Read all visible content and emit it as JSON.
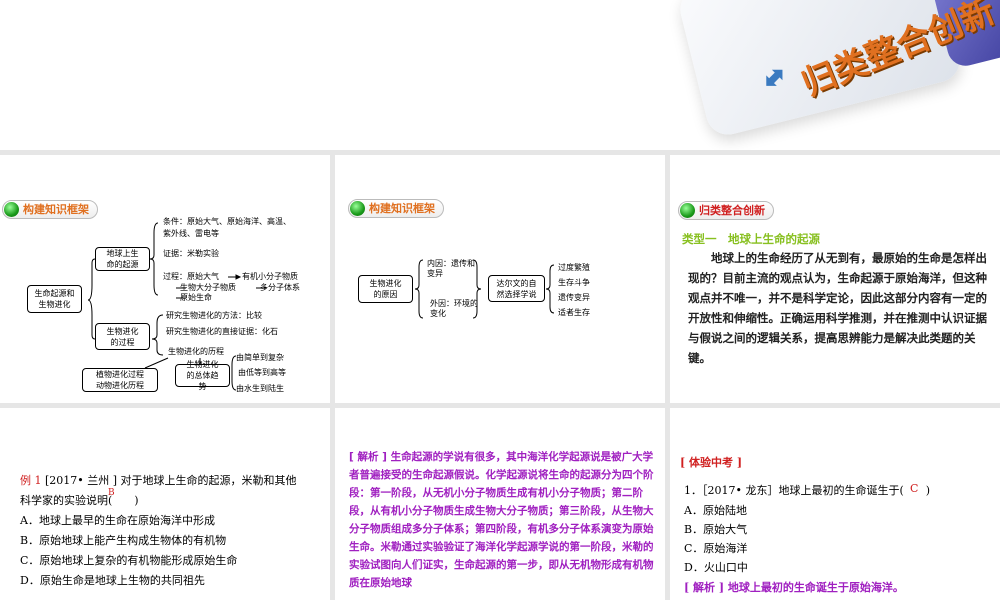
{
  "banner": {
    "title": "归类整合创新"
  },
  "panel1": {
    "badge": "构建知识框架",
    "root": "生命起源和生物进化",
    "origin": "地球上生命的起源",
    "conditions1": "条件：原始大气、原始海洋、高温、",
    "conditions2": "紫外线、雷电等",
    "evidence": "证据：米勒实验",
    "process1": "过程：原始大气",
    "process2": "有机小分子物质",
    "process3": "生物大分子物质",
    "process4": "多分子体系",
    "process5": "原始生命",
    "evolution": "生物进化的过程",
    "method": "研究生物进化的方法：比较",
    "direct": "研究生物进化的直接证据：化石",
    "history": "生物进化的历程",
    "plants": "植物进化过程动物进化历程",
    "trend": "生物进化的总体趋势",
    "trend1": "由简单到复杂",
    "trend2": "由低等到高等",
    "trend3": "由水生到陆生"
  },
  "panel2": {
    "badge": "构建知识框架",
    "cause": "生物进化的原因",
    "internal": "内因：遗传和变异",
    "external": "外因：环境的变化",
    "darwin": "达尔文的自然选择学说",
    "items": [
      "过度繁殖",
      "生存斗争",
      "遗传变异",
      "适者生存"
    ]
  },
  "panel3": {
    "badge": "归类整合创新",
    "heading": "类型一　地球上生命的起源",
    "body": "地球上的生命经历了从无到有，最原始的生命是怎样出现的？目前主流的观点认为，生命起源于原始海洋，但这种观点并不唯一，并不是科学定论，因此这部分内容有一定的开放性和伸缩性。正确运用科学推测，并在推测中认识证据与假说之间的逻辑关系，提高思辨能力是解决此类题的关键。"
  },
  "example": {
    "label": "例 1",
    "source": "[2017• 兰州 ] 对于地球上生命的起源，米勒和其他",
    "line2": "科学家的实验说明(　　)",
    "answer": "B",
    "options": [
      "A．地球上最早的生命在原始海洋中形成",
      "B．原始地球上能产生构成生物体的有机物",
      "C．原始地球上复杂的有机物能形成原始生命",
      "D．原始生命是地球上生物的共同祖先"
    ]
  },
  "analysis": {
    "text": "[ 解析 ] 生命起源的学说有很多，其中海洋化学起源说是被广大学者普遍接受的生命起源假说。化学起源说将生命的起源分为四个阶段：第一阶段，从无机小分子物质生成有机小分子物质；第二阶段，从有机小分子物质生成生物大分子物质；第三阶段，从生物大分子物质组成多分子体系；第四阶段，有机多分子体系演变为原始生命。米勒通过实验验证了海洋化学起源学说的第一阶段，米勒的实验试图向人们证实，生命起源的第一步，即从无机物形成有机物质在原始地球"
  },
  "exam": {
    "heading": "[ 体验中考 ]",
    "question": "1．［2017• 龙东］地球上最初的生命诞生于(　　)",
    "answer": "C",
    "options": [
      "A．原始陆地",
      "B．原始大气",
      "C．原始海洋",
      "D．火山口中"
    ],
    "analysis": "[ 解析 ] 地球上最初的生命诞生于原始海洋。"
  },
  "colors": {
    "accent": "#e07020",
    "purple": "#a020c0",
    "red": "#d02020",
    "green": "#88c020"
  }
}
